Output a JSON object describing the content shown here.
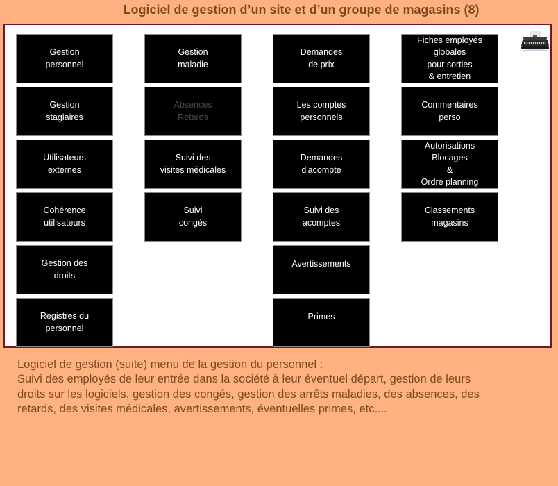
{
  "header": {
    "title": "Logiciel de gestion d’un site et d’un groupe de magasins (8)"
  },
  "menu": {
    "columns": [
      {
        "tiles": [
          {
            "label": "Gestion\npersonnel",
            "enabled": true
          },
          {
            "label": "Gestion\nstagiaires",
            "enabled": true
          },
          {
            "label": "Utilisateurs\nexternes",
            "enabled": true
          },
          {
            "label": "Cohérence\nutilisateurs",
            "enabled": true
          },
          {
            "label": "Gestion des\ndroits",
            "enabled": true
          },
          {
            "label": "Registres du\npersonnel",
            "enabled": true
          }
        ]
      },
      {
        "tiles": [
          {
            "label": "Gestion\nmaladie",
            "enabled": true
          },
          {
            "label": "Absences\nRetards",
            "enabled": false
          },
          {
            "label": "Suivi des\nvisites médicales",
            "enabled": true
          },
          {
            "label": "Suivi\ncongés",
            "enabled": true
          }
        ]
      },
      {
        "tiles": [
          {
            "label": "Demandes\nde prix",
            "enabled": true
          },
          {
            "label": "Les comptes\npersonnels",
            "enabled": true
          },
          {
            "label": "Demandes\nd'acompte",
            "enabled": true
          },
          {
            "label": "Suivi des\nacomptes",
            "enabled": true
          },
          {
            "label": "Avertissements",
            "enabled": true
          },
          {
            "label": "Primes",
            "enabled": true
          }
        ]
      },
      {
        "tiles": [
          {
            "label": "Fiches employés\nglobales\npour sorties\n& entretien",
            "enabled": true
          },
          {
            "label": "Commentaires\nperso",
            "enabled": true
          },
          {
            "label": "Autorisations\nBlocages\n&\nOrdre planning",
            "enabled": true
          },
          {
            "label": "Classements\nmagasins",
            "enabled": true
          }
        ]
      }
    ],
    "corner_icon": "typewriter-icon"
  },
  "description": {
    "lines": [
      "Logiciel de gestion (suite)  menu de la gestion du personnel :",
      "Suivi des employés de leur entrée dans la société à leur éventuel départ, gestion de leurs",
      "droits sur les logiciels, gestion des congés, gestion des arrêts maladies, des absences, des",
      "retards, des visites médicales, avertissements, éventuelles primes, etc...."
    ]
  },
  "colors": {
    "background": "#ffb182",
    "title_text": "#7b4a1e",
    "panel_border": "#6b1a2a",
    "tile_background": "#000000",
    "tile_text": "#ffffff",
    "tile_disabled_text": "#4a4a4a"
  }
}
